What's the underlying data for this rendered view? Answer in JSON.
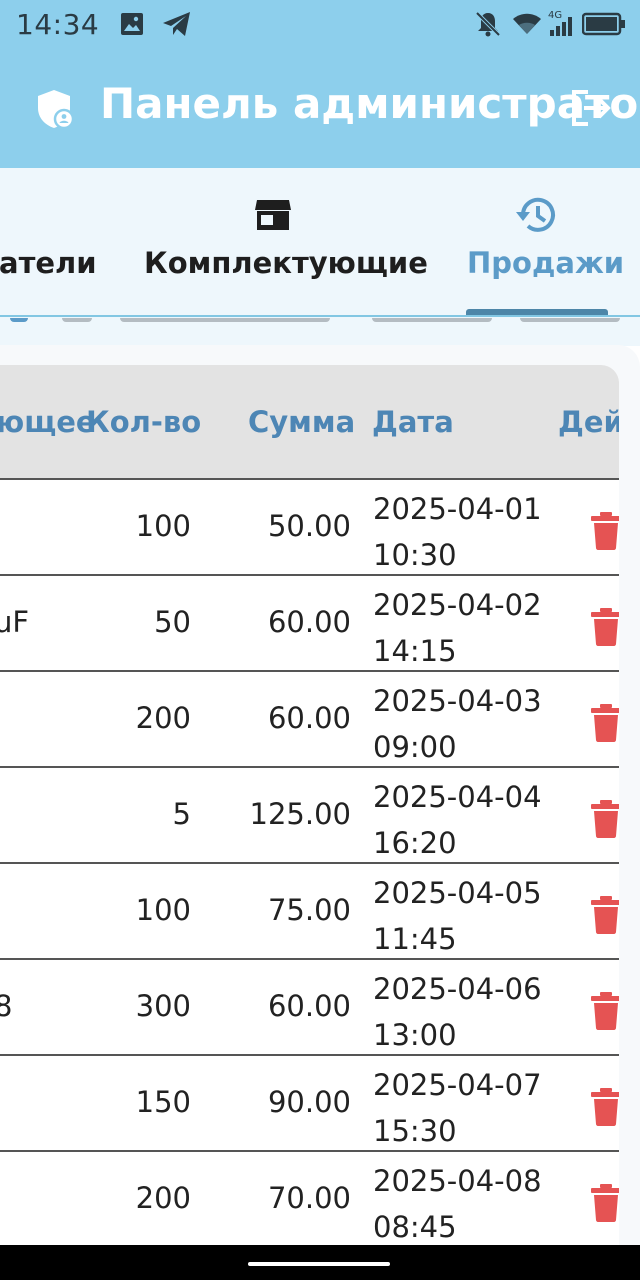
{
  "status_bar": {
    "time": "14:34",
    "left_icons": [
      "gallery-icon",
      "telegram-icon"
    ],
    "right_icons": [
      "bell-off-icon",
      "wifi-icon",
      "signal-4g-icon",
      "battery-icon"
    ],
    "network_type": "4G"
  },
  "app_bar": {
    "title": "Панель администратора",
    "leading_icon": "admin-shield-icon",
    "action_icon": "logout-icon",
    "background": "#8dcfec"
  },
  "tabs": {
    "items": [
      {
        "label": "атели",
        "icon": "people-icon",
        "active": false
      },
      {
        "label": "Комплектующие",
        "icon": "store-icon",
        "active": false
      },
      {
        "label": "Продажи",
        "icon": "history-icon",
        "active": true
      }
    ],
    "active_color": "#5b9bc8",
    "indicator_color": "#4d86a8"
  },
  "table": {
    "columns": [
      "ющее",
      "Кол-во",
      "Сумма",
      "Дата",
      "Дейст"
    ],
    "header_color": "#4d86b5",
    "rows": [
      {
        "name": "",
        "qty": "100",
        "sum": "50.00",
        "date": "2025-04-01",
        "time": "10:30"
      },
      {
        "name": "uF",
        "qty": "50",
        "sum": "60.00",
        "date": "2025-04-02",
        "time": "14:15"
      },
      {
        "name": "",
        "qty": "200",
        "sum": "60.00",
        "date": "2025-04-03",
        "time": "09:00"
      },
      {
        "name": "",
        "qty": "5",
        "sum": "125.00",
        "date": "2025-04-04",
        "time": "16:20"
      },
      {
        "name": "",
        "qty": "100",
        "sum": "75.00",
        "date": "2025-04-05",
        "time": "11:45"
      },
      {
        "name": "8",
        "qty": "300",
        "sum": "60.00",
        "date": "2025-04-06",
        "time": "13:00"
      },
      {
        "name": "",
        "qty": "150",
        "sum": "90.00",
        "date": "2025-04-07",
        "time": "15:30"
      },
      {
        "name": "",
        "qty": "200",
        "sum": "70.00",
        "date": "2025-04-08",
        "time": "08:45"
      }
    ],
    "delete_icon": "trash-icon",
    "delete_color": "#e55353"
  }
}
